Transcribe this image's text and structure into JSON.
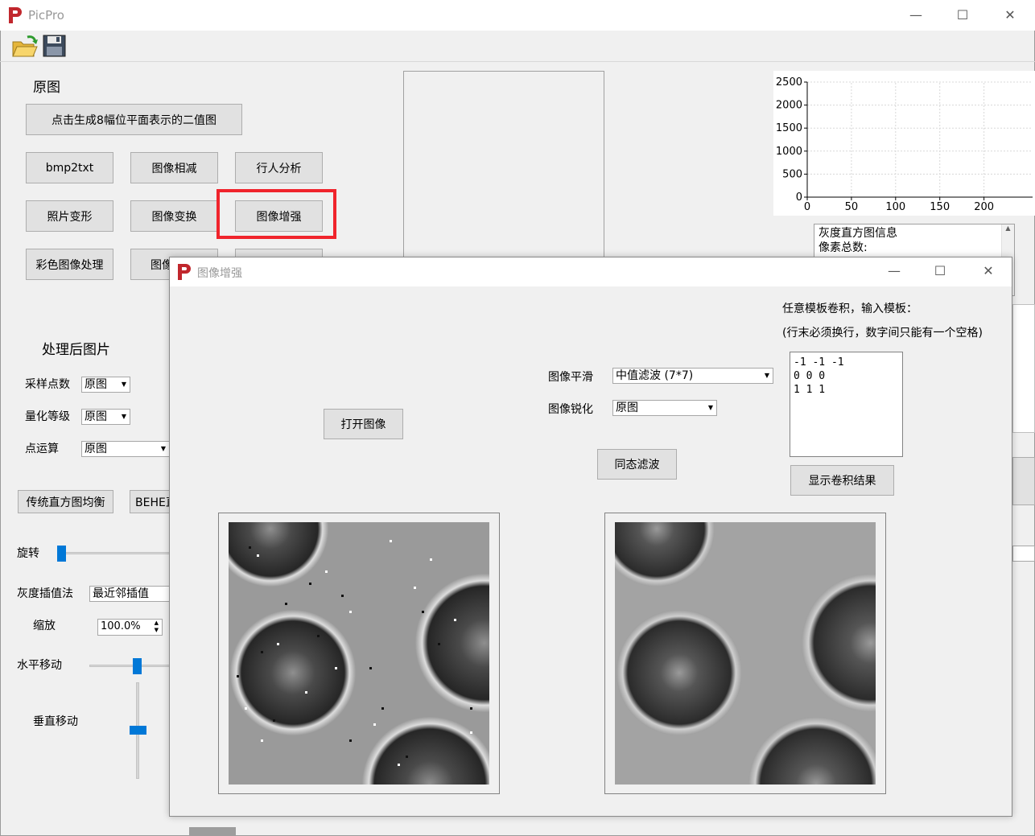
{
  "app": {
    "title": "PicPro",
    "logo_color": "#c1272d"
  },
  "window_controls": {
    "minimize": "—",
    "maximize": "☐",
    "close": "✕"
  },
  "toolbar": {
    "open_icon": "folder-open-icon",
    "save_icon": "floppy-disk-icon"
  },
  "left": {
    "original_label": "原图",
    "gen_bitplane_btn": "点击生成8幅位平面表示的二值图",
    "buttons": {
      "bmp2txt": "bmp2txt",
      "subtract": "图像相减",
      "pedestrian": "行人分析",
      "warp": "照片变形",
      "transform": "图像变换",
      "enhance": "图像增强",
      "color": "彩色图像处理",
      "partial": "图像"
    },
    "processed_label": "处理后图片",
    "sampling_label": "采样点数",
    "sampling_value": "原图",
    "quant_label": "量化等级",
    "quant_value": "原图",
    "point_label": "点运算",
    "point_value": "原图",
    "hist_eq_btn": "传统直方图均衡",
    "behe_btn": "BEHE直",
    "rotate_label": "旋转",
    "interp_label": "灰度插值法",
    "interp_value": "最近邻插值",
    "zoom_label": "缩放",
    "zoom_value": "100.0%",
    "hmove_label": "水平移动",
    "vmove_label": "垂直移动"
  },
  "histogram": {
    "info_lines": [
      "灰度直方图信息",
      "像素总数:"
    ]
  },
  "chart_data": {
    "type": "line",
    "x": [],
    "series": [],
    "xticks": [
      "0",
      "50",
      "100",
      "150",
      "200"
    ],
    "yticks": [
      "0",
      "500",
      "1000",
      "1500",
      "2000",
      "2500"
    ],
    "xlim": [
      0,
      255
    ],
    "ylim": [
      0,
      2500
    ],
    "grid": true
  },
  "dialog": {
    "title": "图像增强",
    "open_btn": "打开图像",
    "smooth_label": "图像平滑",
    "smooth_value": "中值滤波 (7*7)",
    "sharpen_label": "图像锐化",
    "sharpen_value": "原图",
    "homomorphic_btn": "同态滤波",
    "conv_title": "任意模板卷积，输入模板：",
    "conv_hint": "(行末必须换行，数字间只能有一个空格)",
    "conv_template": [
      "-1 -1 -1",
      "0 0 0",
      "1 1 1"
    ],
    "conv_btn": "显示卷积结果"
  }
}
